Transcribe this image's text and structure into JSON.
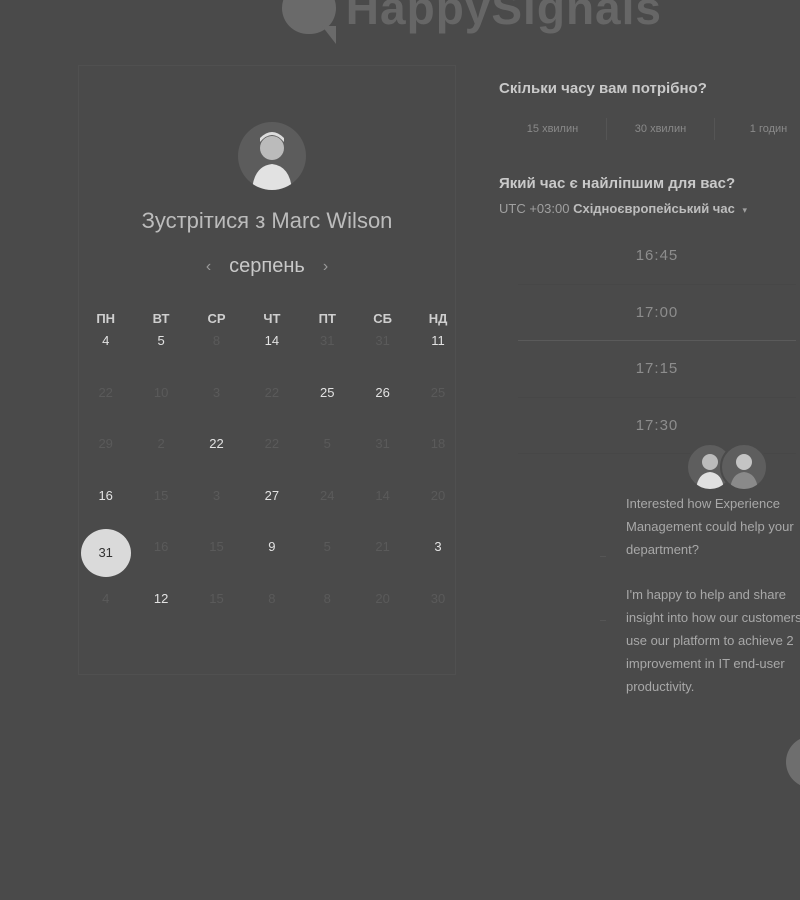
{
  "logo": {
    "text": "HappySignals"
  },
  "calendar": {
    "title_prefix": "Зустрітися з ",
    "host_name": "Marc Wilson",
    "month": "серпень",
    "prev_icon": "‹",
    "next_icon": "›",
    "weekdays": [
      "ПН",
      "ВТ",
      "СР",
      "ЧТ",
      "ПТ",
      "СБ",
      "НД"
    ],
    "weeks": [
      [
        {
          "d": "4",
          "a": true
        },
        {
          "d": "5",
          "a": true
        },
        {
          "d": "8",
          "a": false
        },
        {
          "d": "14",
          "a": true
        },
        {
          "d": "31",
          "a": false
        },
        {
          "d": "31",
          "a": false
        },
        {
          "d": "11",
          "a": true
        }
      ],
      [
        {
          "d": "22",
          "a": false
        },
        {
          "d": "10",
          "a": false
        },
        {
          "d": "3",
          "a": false
        },
        {
          "d": "22",
          "a": false
        },
        {
          "d": "25",
          "a": true
        },
        {
          "d": "26",
          "a": true
        },
        {
          "d": "25",
          "a": false
        }
      ],
      [
        {
          "d": "29",
          "a": false
        },
        {
          "d": "2",
          "a": false
        },
        {
          "d": "22",
          "a": true
        },
        {
          "d": "22",
          "a": false
        },
        {
          "d": "5",
          "a": false
        },
        {
          "d": "31",
          "a": false
        },
        {
          "d": "18",
          "a": false
        }
      ],
      [
        {
          "d": "16",
          "a": true
        },
        {
          "d": "15",
          "a": false
        },
        {
          "d": "3",
          "a": false
        },
        {
          "d": "27",
          "a": true
        },
        {
          "d": "24",
          "a": false
        },
        {
          "d": "14",
          "a": false
        },
        {
          "d": "20",
          "a": false
        }
      ],
      [
        {
          "d": "31",
          "a": true,
          "s": true
        },
        {
          "d": "16",
          "a": false
        },
        {
          "d": "15",
          "a": false
        },
        {
          "d": "9",
          "a": true
        },
        {
          "d": "5",
          "a": false
        },
        {
          "d": "21",
          "a": false
        },
        {
          "d": "3",
          "a": true
        }
      ],
      [
        {
          "d": "4",
          "a": false
        },
        {
          "d": "12",
          "a": true
        },
        {
          "d": "15",
          "a": false
        },
        {
          "d": "8",
          "a": false
        },
        {
          "d": "8",
          "a": false
        },
        {
          "d": "20",
          "a": false
        },
        {
          "d": "30",
          "a": false
        }
      ]
    ]
  },
  "duration": {
    "heading": "Скільки часу вам потрібно?",
    "options": [
      "15 хвилин",
      "30 хвилин",
      "1 годин"
    ]
  },
  "time": {
    "heading": "Який час є найліпшим для вас?",
    "tz_prefix": "UTC +03:00",
    "tz_name": "Східноєвропейський час",
    "tz_caret": "▾",
    "slots": [
      "16:45",
      "17:00",
      "17:15",
      "17:30"
    ]
  },
  "chat": {
    "messages": [
      "Interested how Experience Management could help your department?",
      "I'm happy to help and share insight into how our customers use our platform to achieve 2 improvement in IT end-user productivity."
    ]
  },
  "colors": {
    "background": "#4a4a4a",
    "selected_day": "#dadada"
  }
}
